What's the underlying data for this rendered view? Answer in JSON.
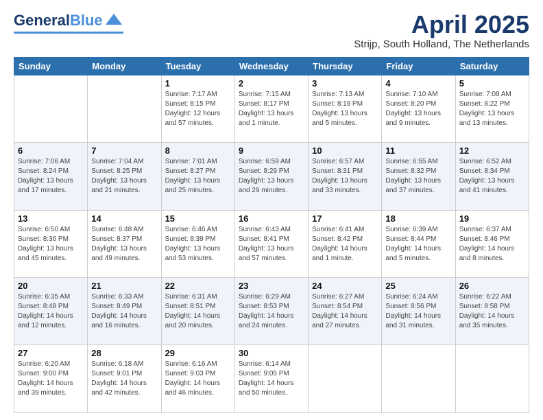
{
  "header": {
    "logo_line1": "General",
    "logo_line2": "Blue",
    "month": "April 2025",
    "location": "Strijp, South Holland, The Netherlands"
  },
  "days_of_week": [
    "Sunday",
    "Monday",
    "Tuesday",
    "Wednesday",
    "Thursday",
    "Friday",
    "Saturday"
  ],
  "weeks": [
    [
      {
        "day": "",
        "info": ""
      },
      {
        "day": "",
        "info": ""
      },
      {
        "day": "1",
        "info": "Sunrise: 7:17 AM\nSunset: 8:15 PM\nDaylight: 12 hours and 57 minutes."
      },
      {
        "day": "2",
        "info": "Sunrise: 7:15 AM\nSunset: 8:17 PM\nDaylight: 13 hours and 1 minute."
      },
      {
        "day": "3",
        "info": "Sunrise: 7:13 AM\nSunset: 8:19 PM\nDaylight: 13 hours and 5 minutes."
      },
      {
        "day": "4",
        "info": "Sunrise: 7:10 AM\nSunset: 8:20 PM\nDaylight: 13 hours and 9 minutes."
      },
      {
        "day": "5",
        "info": "Sunrise: 7:08 AM\nSunset: 8:22 PM\nDaylight: 13 hours and 13 minutes."
      }
    ],
    [
      {
        "day": "6",
        "info": "Sunrise: 7:06 AM\nSunset: 8:24 PM\nDaylight: 13 hours and 17 minutes."
      },
      {
        "day": "7",
        "info": "Sunrise: 7:04 AM\nSunset: 8:25 PM\nDaylight: 13 hours and 21 minutes."
      },
      {
        "day": "8",
        "info": "Sunrise: 7:01 AM\nSunset: 8:27 PM\nDaylight: 13 hours and 25 minutes."
      },
      {
        "day": "9",
        "info": "Sunrise: 6:59 AM\nSunset: 8:29 PM\nDaylight: 13 hours and 29 minutes."
      },
      {
        "day": "10",
        "info": "Sunrise: 6:57 AM\nSunset: 8:31 PM\nDaylight: 13 hours and 33 minutes."
      },
      {
        "day": "11",
        "info": "Sunrise: 6:55 AM\nSunset: 8:32 PM\nDaylight: 13 hours and 37 minutes."
      },
      {
        "day": "12",
        "info": "Sunrise: 6:52 AM\nSunset: 8:34 PM\nDaylight: 13 hours and 41 minutes."
      }
    ],
    [
      {
        "day": "13",
        "info": "Sunrise: 6:50 AM\nSunset: 8:36 PM\nDaylight: 13 hours and 45 minutes."
      },
      {
        "day": "14",
        "info": "Sunrise: 6:48 AM\nSunset: 8:37 PM\nDaylight: 13 hours and 49 minutes."
      },
      {
        "day": "15",
        "info": "Sunrise: 6:46 AM\nSunset: 8:39 PM\nDaylight: 13 hours and 53 minutes."
      },
      {
        "day": "16",
        "info": "Sunrise: 6:43 AM\nSunset: 8:41 PM\nDaylight: 13 hours and 57 minutes."
      },
      {
        "day": "17",
        "info": "Sunrise: 6:41 AM\nSunset: 8:42 PM\nDaylight: 14 hours and 1 minute."
      },
      {
        "day": "18",
        "info": "Sunrise: 6:39 AM\nSunset: 8:44 PM\nDaylight: 14 hours and 5 minutes."
      },
      {
        "day": "19",
        "info": "Sunrise: 6:37 AM\nSunset: 8:46 PM\nDaylight: 14 hours and 8 minutes."
      }
    ],
    [
      {
        "day": "20",
        "info": "Sunrise: 6:35 AM\nSunset: 8:48 PM\nDaylight: 14 hours and 12 minutes."
      },
      {
        "day": "21",
        "info": "Sunrise: 6:33 AM\nSunset: 8:49 PM\nDaylight: 14 hours and 16 minutes."
      },
      {
        "day": "22",
        "info": "Sunrise: 6:31 AM\nSunset: 8:51 PM\nDaylight: 14 hours and 20 minutes."
      },
      {
        "day": "23",
        "info": "Sunrise: 6:29 AM\nSunset: 8:53 PM\nDaylight: 14 hours and 24 minutes."
      },
      {
        "day": "24",
        "info": "Sunrise: 6:27 AM\nSunset: 8:54 PM\nDaylight: 14 hours and 27 minutes."
      },
      {
        "day": "25",
        "info": "Sunrise: 6:24 AM\nSunset: 8:56 PM\nDaylight: 14 hours and 31 minutes."
      },
      {
        "day": "26",
        "info": "Sunrise: 6:22 AM\nSunset: 8:58 PM\nDaylight: 14 hours and 35 minutes."
      }
    ],
    [
      {
        "day": "27",
        "info": "Sunrise: 6:20 AM\nSunset: 9:00 PM\nDaylight: 14 hours and 39 minutes."
      },
      {
        "day": "28",
        "info": "Sunrise: 6:18 AM\nSunset: 9:01 PM\nDaylight: 14 hours and 42 minutes."
      },
      {
        "day": "29",
        "info": "Sunrise: 6:16 AM\nSunset: 9:03 PM\nDaylight: 14 hours and 46 minutes."
      },
      {
        "day": "30",
        "info": "Sunrise: 6:14 AM\nSunset: 9:05 PM\nDaylight: 14 hours and 50 minutes."
      },
      {
        "day": "",
        "info": ""
      },
      {
        "day": "",
        "info": ""
      },
      {
        "day": "",
        "info": ""
      }
    ]
  ]
}
